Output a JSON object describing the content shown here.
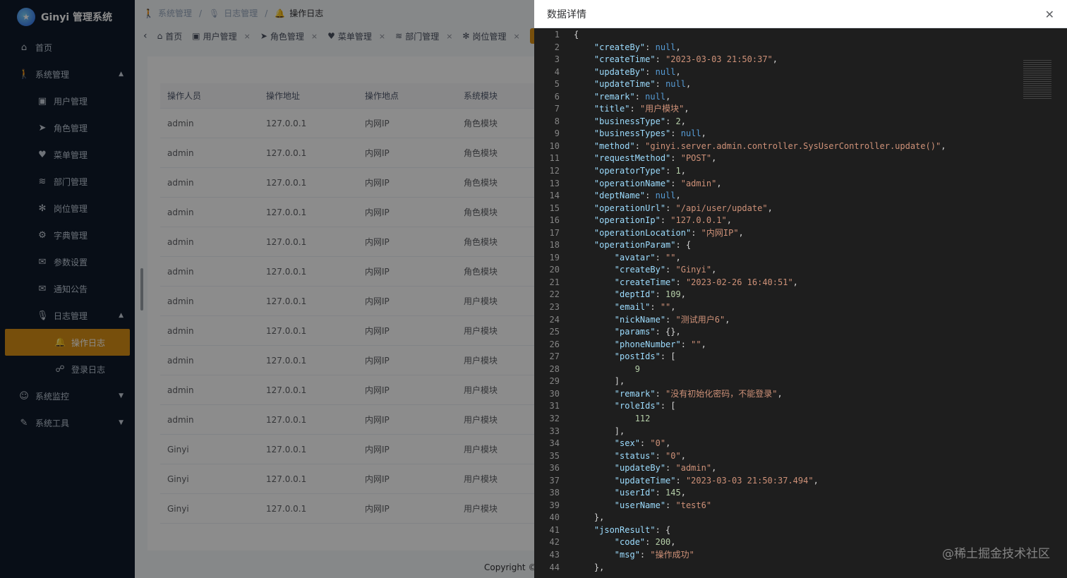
{
  "app": {
    "title": "Ginyi 管理系统"
  },
  "sidebar": {
    "items": [
      {
        "label": "首页",
        "icon": "home-icon",
        "level": 1
      },
      {
        "label": "系统管理",
        "icon": "person-icon",
        "level": 1,
        "expanded": true
      },
      {
        "label": "用户管理",
        "icon": "user-box-icon",
        "level": 2
      },
      {
        "label": "角色管理",
        "icon": "fish-icon",
        "level": 2
      },
      {
        "label": "菜单管理",
        "icon": "heart-icon",
        "level": 2
      },
      {
        "label": "部门管理",
        "icon": "layers-icon",
        "level": 2
      },
      {
        "label": "岗位管理",
        "icon": "paw-icon",
        "level": 2
      },
      {
        "label": "字典管理",
        "icon": "gear-icon",
        "level": 2
      },
      {
        "label": "参数设置",
        "icon": "chat-icon",
        "level": 2
      },
      {
        "label": "通知公告",
        "icon": "mail-icon",
        "level": 2
      },
      {
        "label": "日志管理",
        "icon": "mic-icon",
        "level": 2,
        "expanded": true
      },
      {
        "label": "操作日志",
        "icon": "bell-icon",
        "level": 3,
        "active": true
      },
      {
        "label": "登录日志",
        "icon": "login-icon",
        "level": 3
      },
      {
        "label": "系统监控",
        "icon": "monitor-user-icon",
        "level": 1,
        "collapsed": true
      },
      {
        "label": "系统工具",
        "icon": "wrench-icon",
        "level": 1,
        "collapsed": true
      }
    ]
  },
  "breadcrumb": [
    "系统管理",
    "日志管理",
    "操作日志"
  ],
  "tabs": [
    {
      "label": "首页",
      "closable": false
    },
    {
      "label": "用户管理",
      "closable": true
    },
    {
      "label": "角色管理",
      "closable": true
    },
    {
      "label": "菜单管理",
      "closable": true
    },
    {
      "label": "部门管理",
      "closable": true
    },
    {
      "label": "岗位管理",
      "closable": true
    }
  ],
  "table": {
    "headers": [
      "操作人员",
      "操作地址",
      "操作地点",
      "系统模块"
    ],
    "rows": [
      [
        "admin",
        "127.0.0.1",
        "内网IP",
        "角色模块"
      ],
      [
        "admin",
        "127.0.0.1",
        "内网IP",
        "角色模块"
      ],
      [
        "admin",
        "127.0.0.1",
        "内网IP",
        "角色模块"
      ],
      [
        "admin",
        "127.0.0.1",
        "内网IP",
        "角色模块"
      ],
      [
        "admin",
        "127.0.0.1",
        "内网IP",
        "角色模块"
      ],
      [
        "admin",
        "127.0.0.1",
        "内网IP",
        "角色模块"
      ],
      [
        "admin",
        "127.0.0.1",
        "内网IP",
        "用户模块"
      ],
      [
        "admin",
        "127.0.0.1",
        "内网IP",
        "用户模块"
      ],
      [
        "admin",
        "127.0.0.1",
        "内网IP",
        "用户模块"
      ],
      [
        "admin",
        "127.0.0.1",
        "内网IP",
        "用户模块"
      ],
      [
        "admin",
        "127.0.0.1",
        "内网IP",
        "用户模块"
      ],
      [
        "Ginyi",
        "127.0.0.1",
        "内网IP",
        "用户模块"
      ],
      [
        "Ginyi",
        "127.0.0.1",
        "内网IP",
        "用户模块"
      ],
      [
        "Ginyi",
        "127.0.0.1",
        "内网IP",
        "用户模块"
      ]
    ]
  },
  "footer": {
    "copyright": "Copyright ©"
  },
  "drawer": {
    "title": "数据详情",
    "lines": [
      "{",
      "    \"createBy\": null,",
      "    \"createTime\": \"2023-03-03 21:50:37\",",
      "    \"updateBy\": null,",
      "    \"updateTime\": null,",
      "    \"remark\": null,",
      "    \"title\": \"用户模块\",",
      "    \"businessType\": 2,",
      "    \"businessTypes\": null,",
      "    \"method\": \"ginyi.server.admin.controller.SysUserController.update()\",",
      "    \"requestMethod\": \"POST\",",
      "    \"operatorType\": 1,",
      "    \"operationName\": \"admin\",",
      "    \"deptName\": null,",
      "    \"operationUrl\": \"/api/user/update\",",
      "    \"operationIp\": \"127.0.0.1\",",
      "    \"operationLocation\": \"内网IP\",",
      "    \"operationParam\": {",
      "        \"avatar\": \"\",",
      "        \"createBy\": \"Ginyi\",",
      "        \"createTime\": \"2023-02-26 16:40:51\",",
      "        \"deptId\": 109,",
      "        \"email\": \"\",",
      "        \"nickName\": \"测试用户6\",",
      "        \"params\": {},",
      "        \"phoneNumber\": \"\",",
      "        \"postIds\": [",
      "            9",
      "        ],",
      "        \"remark\": \"没有初始化密码，不能登录\",",
      "        \"roleIds\": [",
      "            112",
      "        ],",
      "        \"sex\": \"0\",",
      "        \"status\": \"0\",",
      "        \"updateBy\": \"admin\",",
      "        \"updateTime\": \"2023-03-03 21:50:37.494\",",
      "        \"userId\": 145,",
      "        \"userName\": \"test6\"",
      "    },",
      "    \"jsonResult\": {",
      "        \"code\": 200,",
      "        \"msg\": \"操作成功\"",
      "    },"
    ]
  },
  "watermark": "@稀土掘金技术社区"
}
